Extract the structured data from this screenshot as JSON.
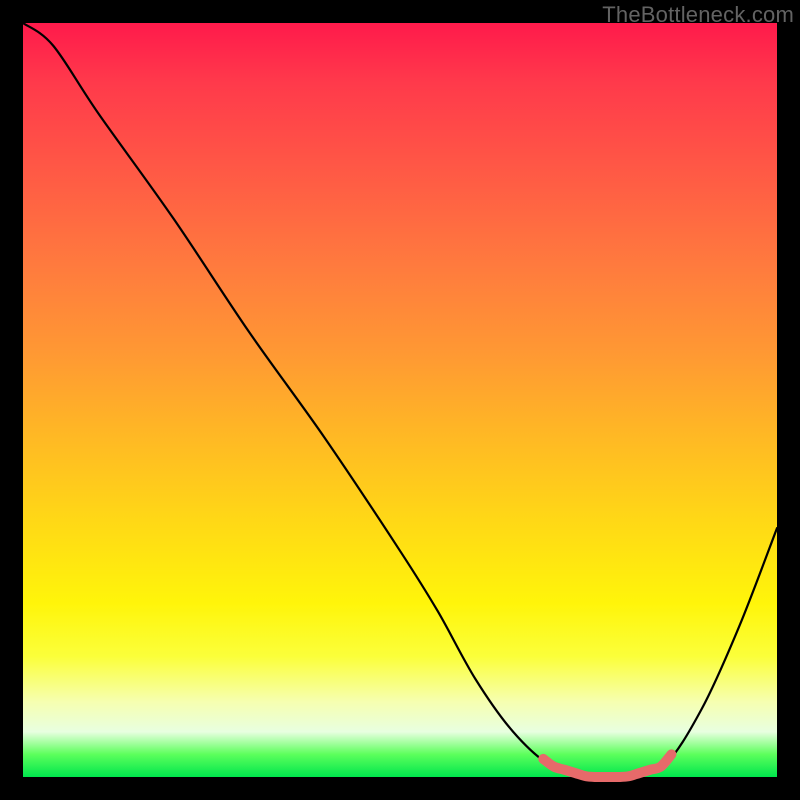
{
  "watermark": "TheBottleneck.com",
  "colors": {
    "frame": "#000000",
    "curve": "#000000",
    "highlight": "#e66a6a"
  },
  "chart_data": {
    "type": "line",
    "title": "",
    "xlabel": "",
    "ylabel": "",
    "xlim": [
      0,
      100
    ],
    "ylim": [
      0,
      100
    ],
    "series": [
      {
        "name": "bottleneck-curve",
        "x": [
          0,
          4,
          10,
          20,
          30,
          40,
          50,
          55,
          60,
          65,
          70,
          75,
          80,
          85,
          90,
          95,
          100
        ],
        "values": [
          100,
          97,
          88,
          74,
          59,
          45,
          30,
          22,
          13,
          6,
          1.5,
          0,
          0,
          1.5,
          9,
          20,
          33
        ]
      }
    ],
    "highlight_range_x": [
      69,
      86
    ]
  }
}
